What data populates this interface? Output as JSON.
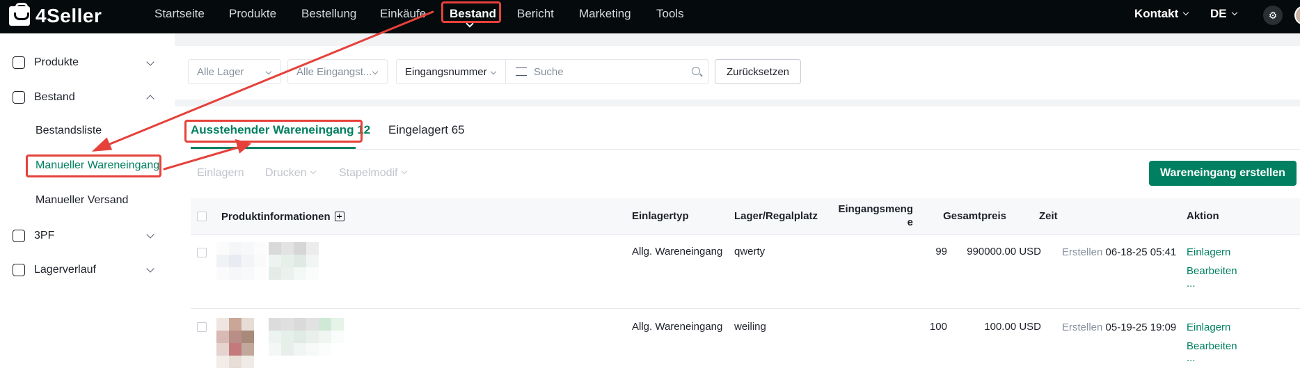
{
  "app": {
    "brand": "4Seller",
    "accent": "#008060",
    "annotation_color": "#e5413a"
  },
  "topnav": {
    "items": [
      {
        "label": "Startseite"
      },
      {
        "label": "Produkte"
      },
      {
        "label": "Bestellung"
      },
      {
        "label": "Einkäufe"
      },
      {
        "label": "Bestand"
      },
      {
        "label": "Bericht"
      },
      {
        "label": "Marketing"
      },
      {
        "label": "Tools"
      }
    ],
    "active": "Bestand",
    "contact": "Kontakt",
    "language": "DE",
    "settings_icon": "gear-icon"
  },
  "sidebar": {
    "groups": [
      {
        "label": "Produkte",
        "icon": "product-icon",
        "expanded": false
      },
      {
        "label": "Bestand",
        "icon": "inventory-icon",
        "expanded": true
      },
      {
        "label": "3PF",
        "icon": "warehouse-icon",
        "expanded": false
      },
      {
        "label": "Lagerverlauf",
        "icon": "history-icon",
        "expanded": false
      }
    ],
    "sub_items": [
      {
        "label": "Bestandsliste"
      },
      {
        "label": "Manueller Wareneingang"
      },
      {
        "label": "Manueller Versand"
      }
    ],
    "active_sub": "Manueller Wareneingang"
  },
  "filters": {
    "warehouse": "Alle Lager",
    "inbound_type": "Alle Eingangst...",
    "search_field": "Eingangsnummer",
    "search_placeholder": "Suche",
    "reset": "Zurücksetzen"
  },
  "tabs": [
    {
      "label": "Ausstehender Wareneingang 12",
      "active": true
    },
    {
      "label": "Eingelagert 65",
      "active": false
    }
  ],
  "toolbar": {
    "store": "Einlagern",
    "print": "Drucken",
    "batch_modify": "Stapelmodif",
    "create": "Wareneingang erstellen"
  },
  "table": {
    "columns": {
      "product": "Produktinformationen",
      "type": "Einlagertyp",
      "location": "Lager/Regalplatz",
      "qty_line1": "Eingangsmeng",
      "qty_line2": "e",
      "total": "Gesamtpreis",
      "time": "Zeit",
      "action": "Aktion"
    },
    "rows": [
      {
        "type": "Allg. Wareneingang",
        "location": "qwerty",
        "qty": "99",
        "total": "990000.00 USD",
        "time_label": "Erstellen",
        "time": "06-18-25 05:41",
        "actions": [
          "Einlagern",
          "Bearbeiten",
          "..."
        ]
      },
      {
        "type": "Allg. Wareneingang",
        "location": "weiling",
        "qty": "100",
        "total": "100.00 USD",
        "time_label": "Erstellen",
        "time": "05-19-25 19:09",
        "actions": [
          "Einlagern",
          "Bearbeiten",
          "..."
        ]
      }
    ]
  }
}
